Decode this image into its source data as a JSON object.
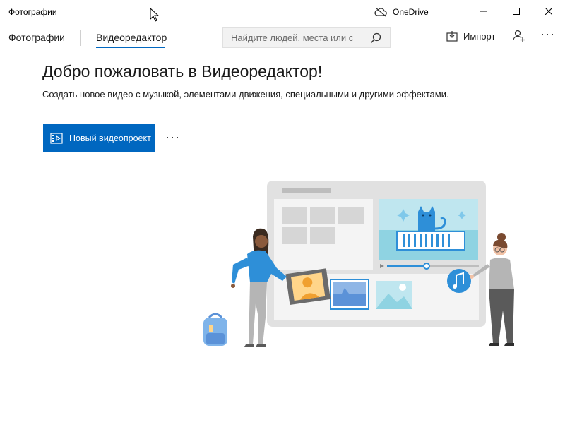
{
  "window": {
    "title": "Фотографии",
    "onedrive_label": "OneDrive"
  },
  "nav": {
    "tabs": [
      {
        "label": "Фотографии",
        "active": false
      },
      {
        "label": "Видеоредактор",
        "active": true
      }
    ],
    "search": {
      "placeholder": "Найдите людей, места или с"
    },
    "import_label": "Импорт"
  },
  "main": {
    "title": "Добро пожаловать в Видеоредактор!",
    "subtitle": "Создать новое видео с музыкой, элементами движения, специальными и другими эффектами.",
    "new_project_label": "Новый видеопроект",
    "more_label": "···"
  },
  "colors": {
    "accent": "#0067c0",
    "illustration_blue": "#2e8fd8"
  },
  "icons": {
    "onedrive": "cloud-off-icon",
    "search": "search-icon",
    "import": "import-icon",
    "people": "person-add-icon",
    "more": "more-icon",
    "new_project": "video-project-icon"
  }
}
